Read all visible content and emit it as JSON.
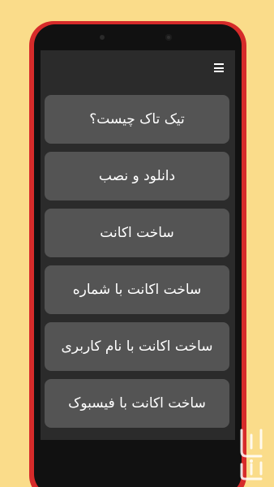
{
  "menu": {
    "icon": "hamburger-menu-icon",
    "items": [
      {
        "label": "تیک تاک چیست؟"
      },
      {
        "label": "دانلود و نصب"
      },
      {
        "label": "ساخت اکانت"
      },
      {
        "label": "ساخت اکانت با شماره"
      },
      {
        "label": "ساخت اکانت با نام کاربری"
      },
      {
        "label": "ساخت اکانت با فیسبوک"
      }
    ]
  },
  "colors": {
    "background": "#fadc8a",
    "phone_frame": "#d62b2a",
    "screen": "#2b2b2b",
    "button": "#545454",
    "text": "#ffffff"
  },
  "watermark": {
    "label": "بازار"
  }
}
